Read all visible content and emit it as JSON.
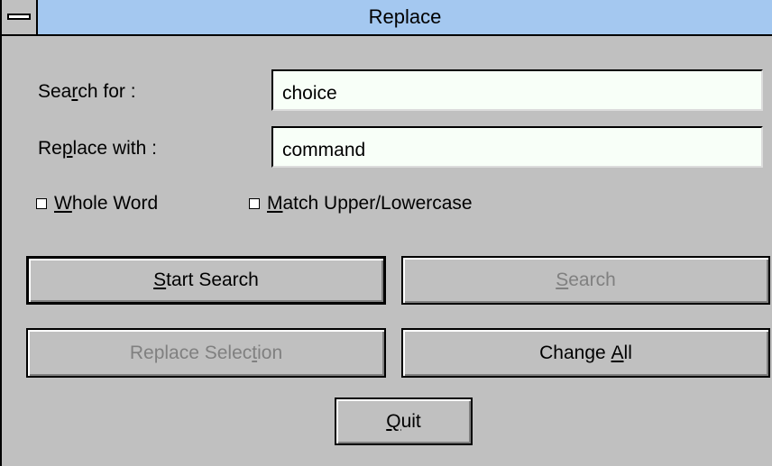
{
  "window": {
    "title": "Replace"
  },
  "search_for": {
    "label_pre": "Sea",
    "label_accel": "r",
    "label_post": "ch for :",
    "value": "choice"
  },
  "replace_with": {
    "label_pre": "Re",
    "label_accel": "p",
    "label_post": "lace with :",
    "value": "command"
  },
  "options": {
    "whole_word": {
      "accel": "W",
      "rest": "hole Word",
      "checked": false
    },
    "match_case": {
      "accel": "M",
      "rest": "atch Upper/Lowercase",
      "checked": false
    }
  },
  "buttons": {
    "start_search": {
      "accel": "S",
      "rest": "tart Search",
      "enabled": true
    },
    "search": {
      "accel": "S",
      "rest": "earch",
      "enabled": false
    },
    "replace_selection": {
      "pre": "Replace Selec",
      "accel": "t",
      "post": "ion",
      "enabled": false
    },
    "change_all": {
      "pre": "Change ",
      "accel": "A",
      "post": "ll",
      "enabled": true
    },
    "quit": {
      "accel": "Q",
      "rest": "uit",
      "enabled": true
    }
  }
}
